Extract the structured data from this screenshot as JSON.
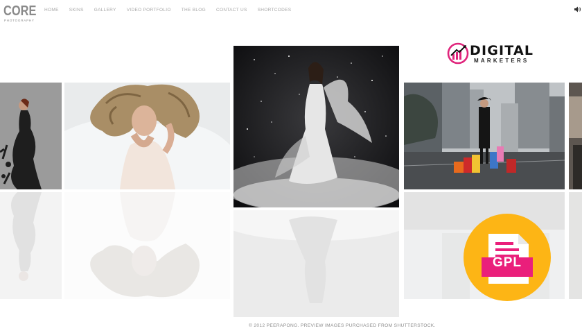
{
  "brand": {
    "name": "CORE",
    "tagline": "PHOTOGRAPHY"
  },
  "nav": {
    "items": [
      "HOME",
      "SKINS",
      "GALLERY",
      "VIDEO PORTFOLIO",
      "THE BLOG",
      "CONTACT US",
      "SHORTCODES"
    ]
  },
  "icons": {
    "volume": "volume-icon",
    "gpl": "document-icon"
  },
  "gallery": {
    "images": [
      {
        "subject": "woman in black dress with ink splash"
      },
      {
        "subject": "woman with flowing hair lying on white bed"
      },
      {
        "subject": "woman in white gown in starry dark space"
      },
      {
        "subject": "woman with shopping bags on city street"
      },
      {
        "subject": "partial image"
      }
    ]
  },
  "overlay_logo": {
    "title": "DIGITAL",
    "subtitle": "MARKETERS",
    "accent": "#e0257c"
  },
  "gpl_badge": {
    "label": "GPL",
    "circle_color": "#fdb515",
    "file_color": "#ea1f7b"
  },
  "footer": {
    "copyright": "© 2012 PEERAPONG. PREVIEW IMAGES PURCHASED FROM SHUTTERSTOCK."
  }
}
